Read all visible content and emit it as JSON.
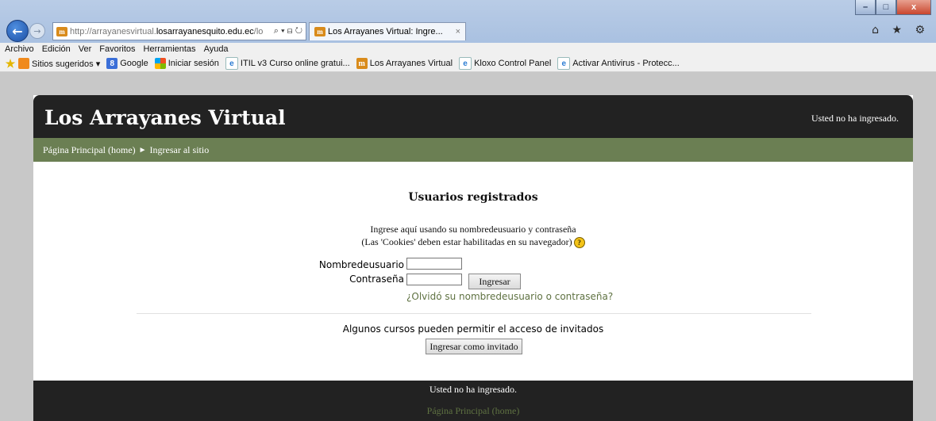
{
  "browser": {
    "window_controls": {
      "minimize": "–",
      "maximize": "□",
      "close": "x"
    },
    "address": {
      "prefix": "http://arrayanesvirtual.",
      "domain": "losarrayanesquito.edu.ec",
      "suffix": "/lo",
      "tools": "⌕ ▾ ⊟ ↻"
    },
    "site_icon_glyph": "m",
    "tab": {
      "title": "Los Arrayanes Virtual: Ingre...",
      "close": "×"
    },
    "chrome_icons": "⌂ ★ ⚙",
    "menu": [
      "Archivo",
      "Edición",
      "Ver",
      "Favoritos",
      "Herramientas",
      "Ayuda"
    ],
    "favorites": [
      {
        "label": "Sitios sugeridos ▾"
      },
      {
        "label": "Google"
      },
      {
        "label": "Iniciar sesión"
      },
      {
        "label": "ITIL v3 Curso online gratui..."
      },
      {
        "label": "Los Arrayanes Virtual"
      },
      {
        "label": "Kloxo Control Panel"
      },
      {
        "label": "Activar Antivirus - Protecc..."
      }
    ]
  },
  "page": {
    "site_title": "Los Arrayanes Virtual",
    "login_info": "Usted no ha ingresado.",
    "breadcrumb": {
      "home": "Página Principal (home)",
      "separator": "►",
      "current": "Ingresar al sitio"
    },
    "login": {
      "heading": "Usuarios registrados",
      "instruction_1": "Ingrese aquí usando su nombredeusuario y contraseña",
      "instruction_2": "(Las 'Cookies' deben estar habilitadas en su navegador)",
      "help_glyph": "?",
      "username_label": "Nombredeusuario",
      "password_label": "Contraseña",
      "username_value": "",
      "password_value": "",
      "login_button": "Ingresar",
      "forgot_link": "¿Olvidó su nombredeusuario o contraseña?"
    },
    "guest": {
      "text": "Algunos cursos pueden permitir el acceso de invitados",
      "button": "Ingresar como invitado"
    },
    "footer": {
      "login_info": "Usted no ha ingresado.",
      "home_link": "Página Principal (home)"
    }
  }
}
